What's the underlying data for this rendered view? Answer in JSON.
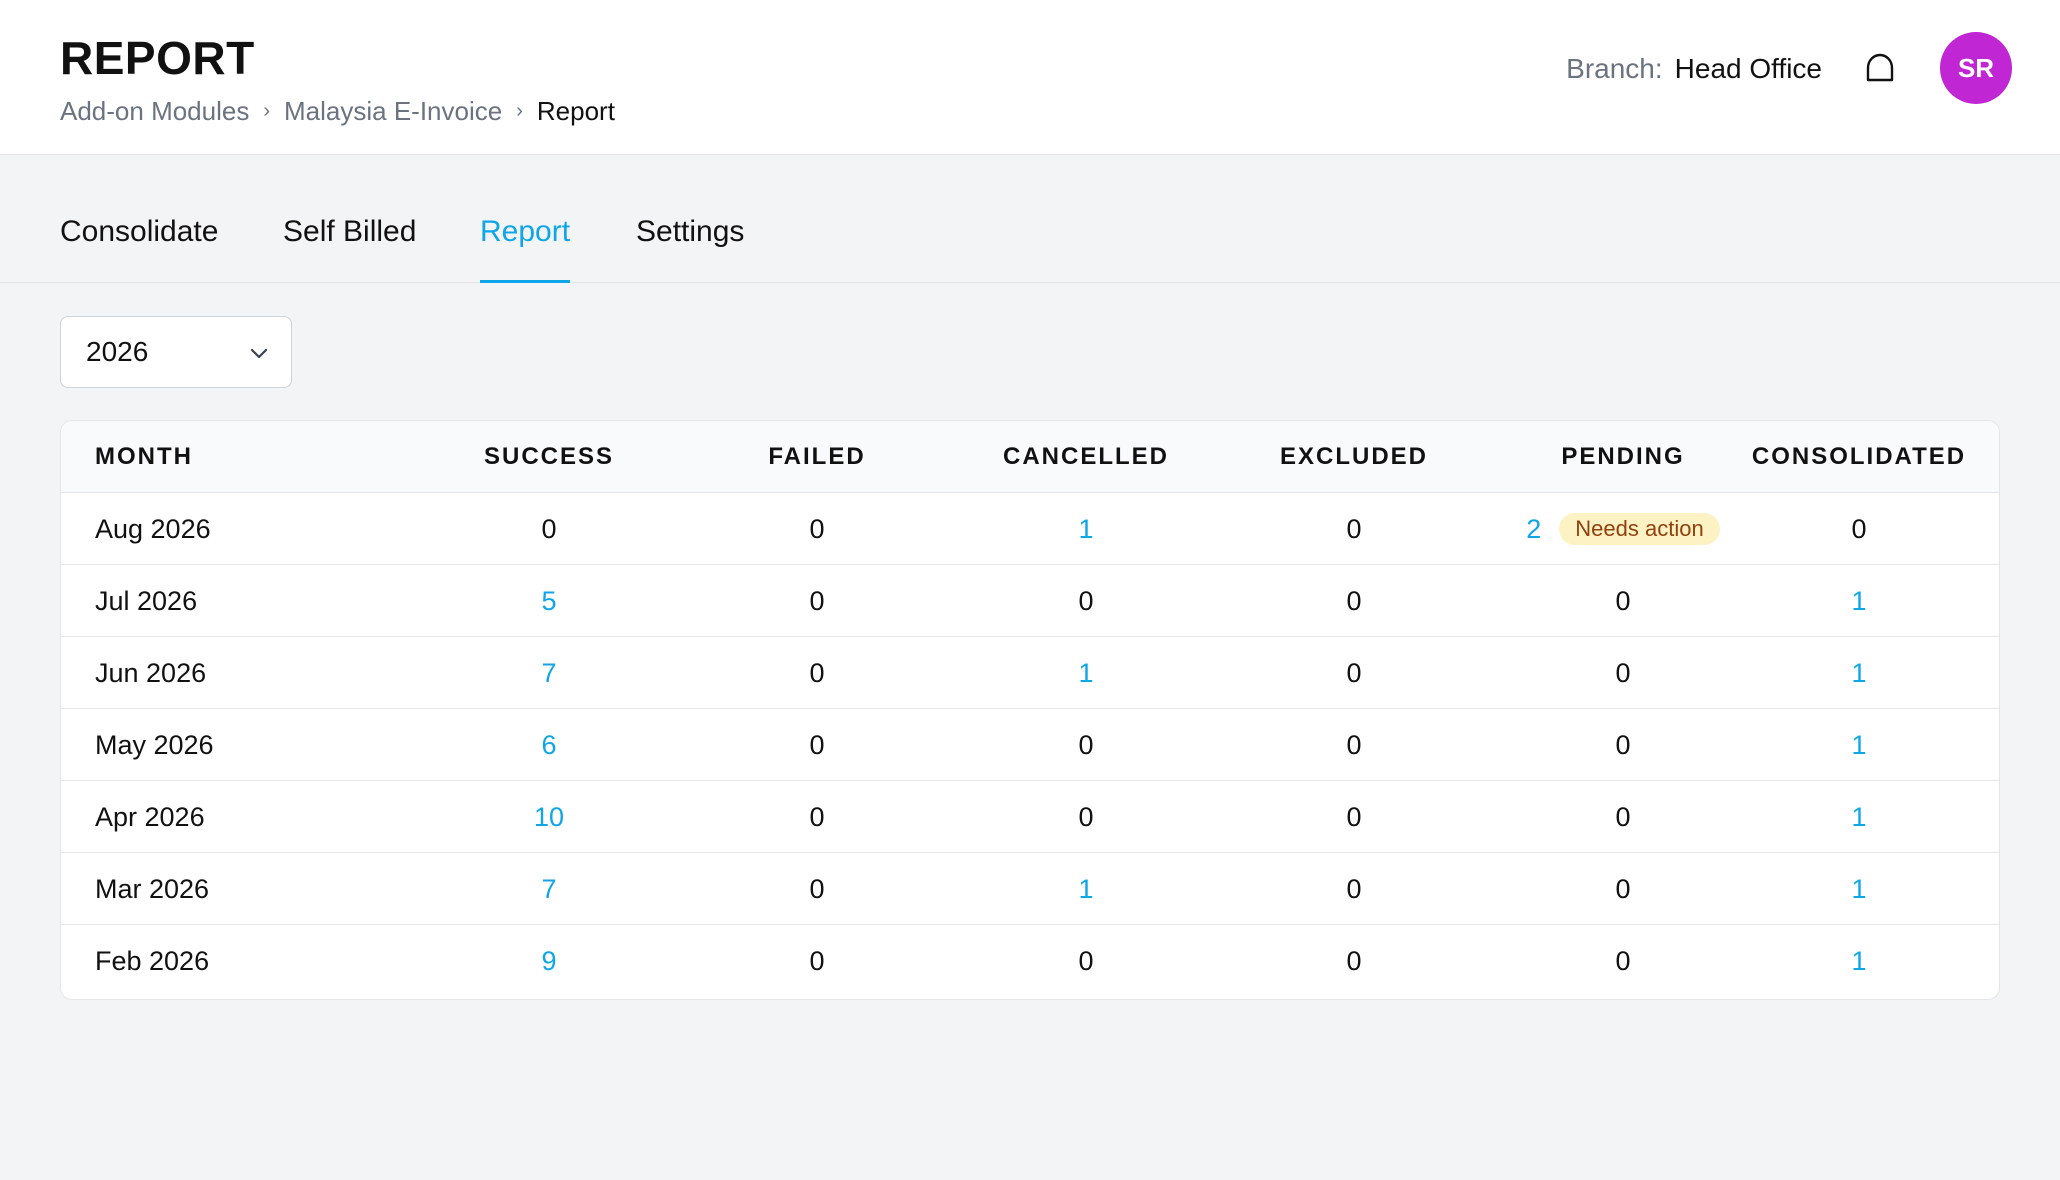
{
  "header": {
    "title": "REPORT",
    "breadcrumb": [
      "Add-on Modules",
      "Malaysia E-Invoice",
      "Report"
    ],
    "branch_label": "Branch:",
    "branch_value": "Head Office",
    "avatar_initials": "SR",
    "avatar_color": "#c026d3"
  },
  "tabs": [
    {
      "label": "Consolidate",
      "active": false
    },
    {
      "label": "Self Billed",
      "active": false
    },
    {
      "label": "Report",
      "active": true
    },
    {
      "label": "Settings",
      "active": false
    }
  ],
  "filter": {
    "year": "2026"
  },
  "table": {
    "columns": [
      "MONTH",
      "SUCCESS",
      "FAILED",
      "CANCELLED",
      "EXCLUDED",
      "PENDING",
      "CONSOLIDATED"
    ],
    "rows": [
      {
        "month": "Aug 2026",
        "success": "0",
        "failed": "0",
        "cancelled": "1",
        "excluded": "0",
        "pending": "2",
        "pending_badge": "Needs action",
        "consolidated": "0"
      },
      {
        "month": "Jul 2026",
        "success": "5",
        "failed": "0",
        "cancelled": "0",
        "excluded": "0",
        "pending": "0",
        "consolidated": "1"
      },
      {
        "month": "Jun 2026",
        "success": "7",
        "failed": "0",
        "cancelled": "1",
        "excluded": "0",
        "pending": "0",
        "consolidated": "1"
      },
      {
        "month": "May 2026",
        "success": "6",
        "failed": "0",
        "cancelled": "0",
        "excluded": "0",
        "pending": "0",
        "consolidated": "1"
      },
      {
        "month": "Apr 2026",
        "success": "10",
        "failed": "0",
        "cancelled": "0",
        "excluded": "0",
        "pending": "0",
        "consolidated": "1"
      },
      {
        "month": "Mar 2026",
        "success": "7",
        "failed": "0",
        "cancelled": "1",
        "excluded": "0",
        "pending": "0",
        "consolidated": "1"
      },
      {
        "month": "Feb 2026",
        "success": "9",
        "failed": "0",
        "cancelled": "0",
        "excluded": "0",
        "pending": "0",
        "consolidated": "1"
      }
    ]
  },
  "colors": {
    "accent": "#0ea5e9",
    "badge_bg": "#fdf2c4",
    "badge_text": "#92400e"
  },
  "icons": {
    "notifications": "bell-icon",
    "select": "chevron-down-icon"
  }
}
